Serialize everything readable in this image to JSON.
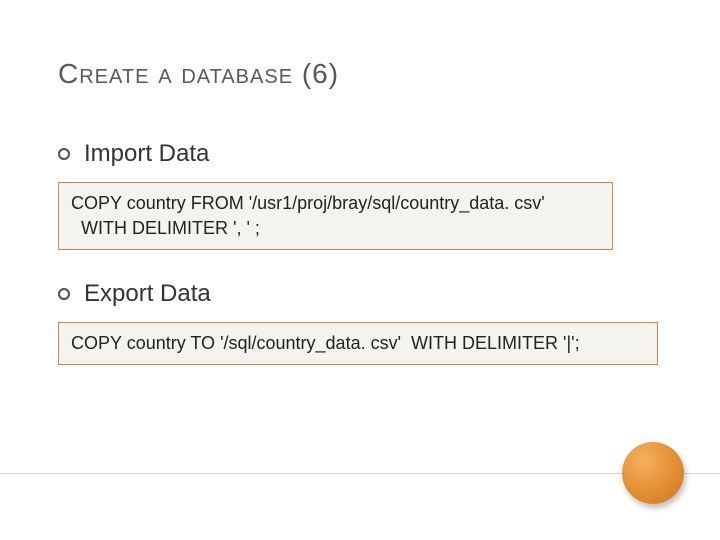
{
  "title": {
    "text": "Create a database",
    "num": "(6)"
  },
  "sections": {
    "import": {
      "label": "Import Data",
      "code": "COPY country FROM '/usr1/proj/bray/sql/country_data. csv'\n  WITH DELIMITER ', ' ;"
    },
    "export": {
      "label": "Export Data",
      "code": "COPY country TO '/sql/country_data. csv'  WITH DELIMITER '|';"
    }
  },
  "colors": {
    "accent": "#d9834a"
  }
}
